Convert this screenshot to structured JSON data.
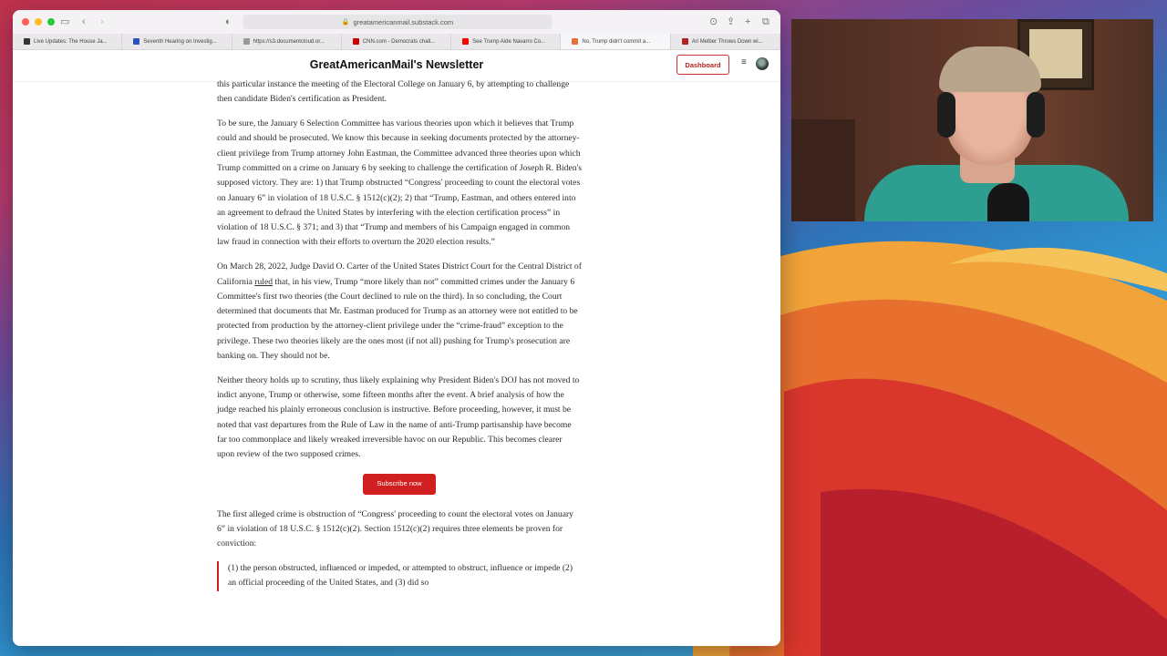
{
  "browser": {
    "url": "greatamericanmail.substack.com",
    "tabs": [
      {
        "label": "Live Updates: The House Ja...",
        "color": "#333333"
      },
      {
        "label": "Seventh Hearing on Investig...",
        "color": "#2a52be"
      },
      {
        "label": "https://s3.documentcloud.or...",
        "color": "#999999"
      },
      {
        "label": "CNN.com - Democrats chall...",
        "color": "#cc0000"
      },
      {
        "label": "See Trump Aide Navarro Co...",
        "color": "#ff0000"
      },
      {
        "label": "No, Trump didn't commit a...",
        "color": "#e8703a"
      },
      {
        "label": "Ari Melber Throws Down wi...",
        "color": "#b22222"
      }
    ]
  },
  "site": {
    "title": "GreatAmericanMail's Newsletter",
    "dashboard_label": "Dashboard"
  },
  "article": {
    "p0": "this particular instance the meeting of the Electoral College on January 6, by attempting to challenge then candidate Biden's certification as President.",
    "p1": "To be sure, the January 6 Selection Committee has various theories upon which it believes that Trump could and should be prosecuted. We know this because in seeking documents protected by the attorney-client privilege from Trump attorney John Eastman, the Committee advanced three theories upon which Trump committed on a crime on January 6 by seeking to challenge the certification of Joseph R. Biden's supposed victory. They are: 1) that Trump obstructed “Congress' proceeding to count the electoral votes on January 6” in violation of 18 U.S.C. § 1512(c)(2); 2) that “Trump, Eastman, and others entered into an agreement to defraud the United States by interfering with the election certification process” in violation of 18 U.S.C. § 371; and 3) that “Trump and members of his Campaign engaged in common law fraud in connection with their efforts to overturn the 2020 election results.”",
    "p2_a": "On March 28, 2022, Judge David O. Carter of the United States District Court for the Central District of California ",
    "p2_link": "ruled",
    "p2_b": " that, in his view, Trump “more likely than not” committed crimes under the January 6 Committee's first two theories (the Court declined to rule on the third). In so concluding, the Court determined that documents that Mr. Eastman produced for Trump as an attorney were not entitled to be protected from production by the attorney-client privilege under the “crime-fraud” exception to the privilege. These two theories likely are the ones most (if not all) pushing for Trump's prosecution are banking on. They should not be.",
    "p3": "Neither theory holds up to scrutiny, thus likely explaining why President Biden's DOJ has not moved to indict anyone, Trump or otherwise, some fifteen months after the event. A brief analysis of how the judge reached his plainly erroneous conclusion is instructive. Before proceeding, however, it must be noted that vast departures from the Rule of Law in the name of anti-Trump partisanship have become far too commonplace and likely wreaked irreversible havoc on our Republic. This becomes clearer upon review of the two supposed crimes.",
    "subscribe_label": "Subscribe now",
    "p4": "The first alleged crime is obstruction of “Congress' proceeding to count the electoral votes on January 6” in violation of 18 U.S.C. § 1512(c)(2). Section 1512(c)(2) requires three elements be proven for conviction:",
    "quote": "(1) the person obstructed, influenced or impeded, or attempted to obstruct, influence or impede (2) an official proceeding of the United States, and (3) did so"
  }
}
